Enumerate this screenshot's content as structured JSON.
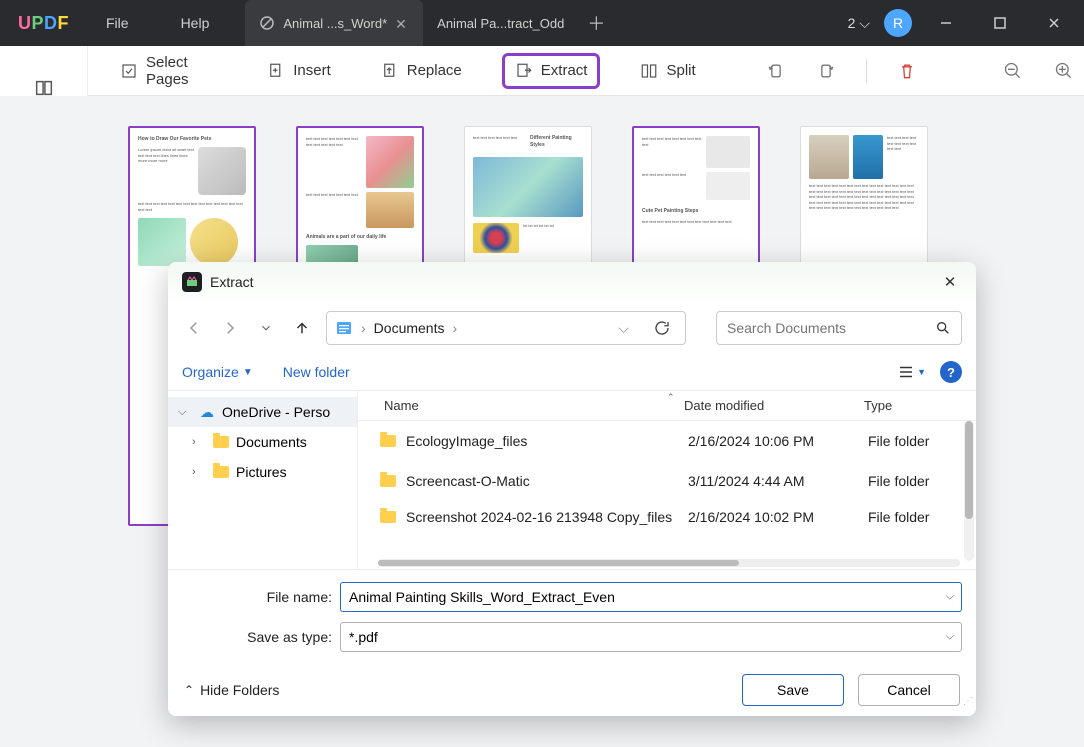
{
  "logo": {
    "u": "U",
    "p": "P",
    "d": "D",
    "f": "F"
  },
  "titlebar": {
    "menu_file": "File",
    "menu_help": "Help",
    "tab_active": "Animal ...s_Word*",
    "tab_inactive": "Animal Pa...tract_Odd",
    "page_drop": "2",
    "avatar_letter": "R"
  },
  "toolbar": {
    "select_pages": "Select Pages",
    "insert": "Insert",
    "replace": "Replace",
    "extract": "Extract",
    "split": "Split"
  },
  "thumbs": {
    "t1_title": "How to Draw Our Favorite Pets",
    "t2_caption": "Animals are a part of our daily life",
    "t3_title": "Different Painting Styles",
    "t4_title": "Cute Pet Painting Steps"
  },
  "dialog": {
    "title": "Extract",
    "breadcrumb_root": "Documents",
    "organize": "Organize",
    "new_folder": "New folder",
    "search_placeholder": "Search Documents",
    "tree_root": "OneDrive - Perso",
    "tree_docs": "Documents",
    "tree_pics": "Pictures",
    "columns": {
      "name": "Name",
      "date": "Date modified",
      "type": "Type"
    },
    "rows": [
      {
        "name": "EcologyImage_files",
        "date": "2/16/2024 10:06 PM",
        "type": "File folder"
      },
      {
        "name": "Screencast-O-Matic",
        "date": "3/11/2024 4:44 AM",
        "type": "File folder"
      },
      {
        "name": "Screenshot 2024-02-16 213948 Copy_files",
        "date": "2/16/2024 10:02 PM",
        "type": "File folder"
      }
    ],
    "filename_label": "File name:",
    "filename_value": "Animal Painting Skills_Word_Extract_Even",
    "saveas_label": "Save as type:",
    "saveas_value": "*.pdf",
    "hide_folders": "Hide Folders",
    "save": "Save",
    "cancel": "Cancel"
  }
}
